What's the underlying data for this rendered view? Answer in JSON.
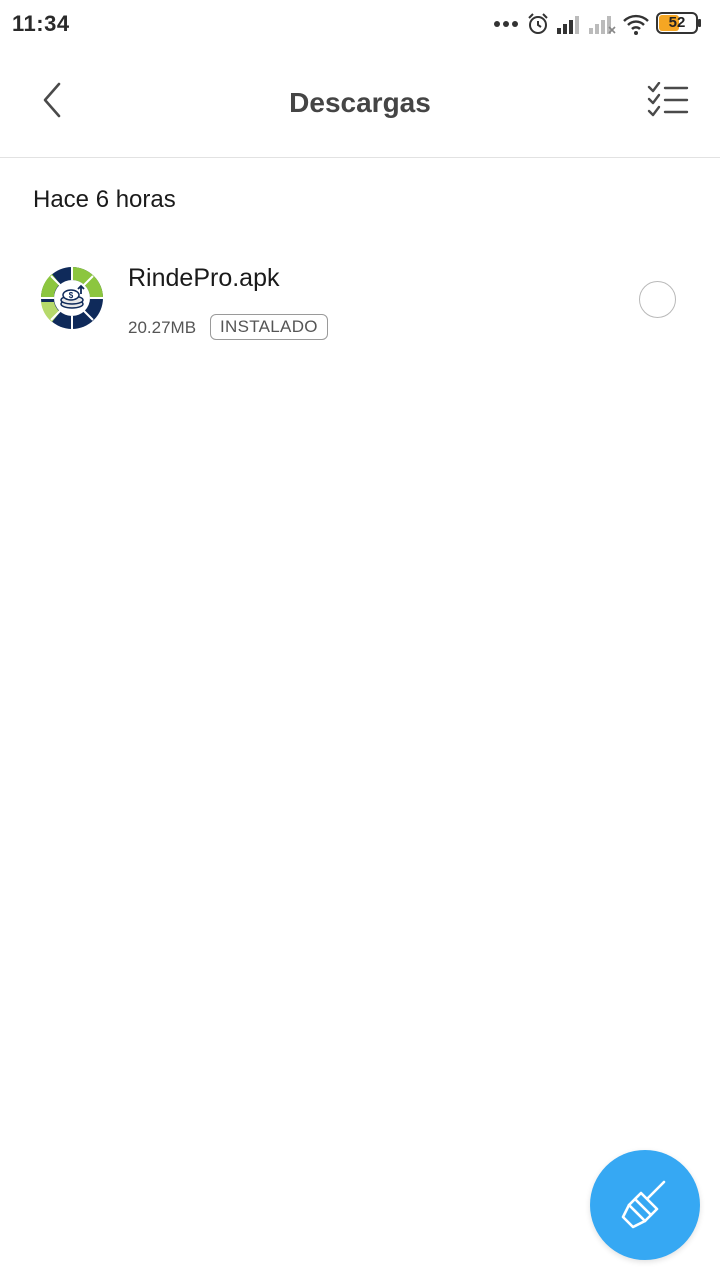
{
  "status_bar": {
    "time": "11:34",
    "battery_level": "52",
    "icons": [
      "more-dots-icon",
      "alarm-icon",
      "signal-1-icon",
      "signal-2-no-service-icon",
      "wifi-icon",
      "battery-icon"
    ]
  },
  "header": {
    "title": "Descargas",
    "back_icon": "chevron-left-icon",
    "select_icon": "checklist-icon"
  },
  "section": {
    "title": "Hace 6 horas"
  },
  "downloads": [
    {
      "file_name": "RindePro.apk",
      "size": "20.27MB",
      "status": "INSTALADO",
      "selected": false,
      "icon": "rindepro-app-icon"
    }
  ],
  "fab": {
    "icon": "broom-clean-icon",
    "color": "#36a8f3"
  },
  "colors": {
    "accent": "#36a8f3",
    "battery_fill": "#f5a623",
    "logo_navy": "#0f2a5a",
    "logo_green": "#8cc63f"
  }
}
